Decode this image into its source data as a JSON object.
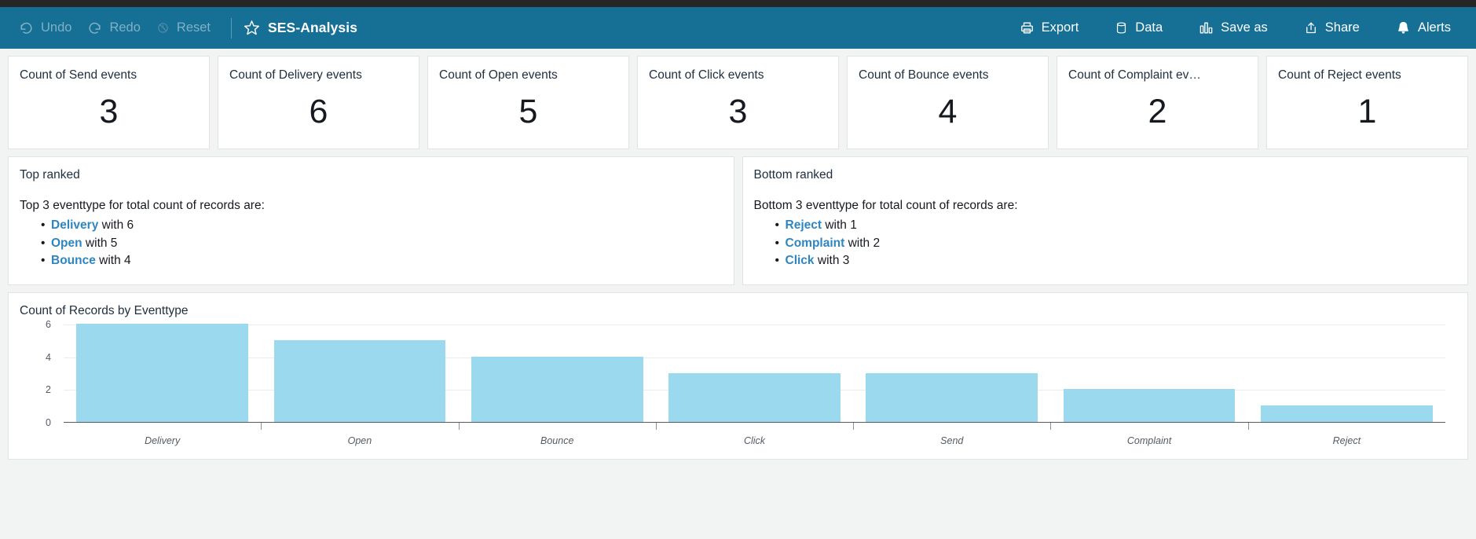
{
  "toolbar": {
    "undo": "Undo",
    "redo": "Redo",
    "reset": "Reset",
    "title": "SES-Analysis",
    "export": "Export",
    "data": "Data",
    "save_as": "Save as",
    "share": "Share",
    "alerts": "Alerts",
    "accent_color": "#166f94",
    "top_strip_color": "#262626"
  },
  "kpis": [
    {
      "title": "Count of Send events",
      "value": "3"
    },
    {
      "title": "Count of Delivery events",
      "value": "6"
    },
    {
      "title": "Count of Open events",
      "value": "5"
    },
    {
      "title": "Count of Click events",
      "value": "3"
    },
    {
      "title": "Count of Bounce events",
      "value": "4"
    },
    {
      "title": "Count of Complaint ev…",
      "value": "2"
    },
    {
      "title": "Count of Reject events",
      "value": "1"
    }
  ],
  "insights": {
    "top": {
      "header": "Top ranked",
      "lead": "Top 3 eventtype for total count of records are:",
      "items": [
        {
          "name": "Delivery",
          "rest": " with 6"
        },
        {
          "name": "Open",
          "rest": " with 5"
        },
        {
          "name": "Bounce",
          "rest": " with 4"
        }
      ]
    },
    "bottom": {
      "header": "Bottom ranked",
      "lead": "Bottom 3 eventtype for total count of records are:",
      "items": [
        {
          "name": "Reject",
          "rest": " with 1"
        },
        {
          "name": "Complaint",
          "rest": " with 2"
        },
        {
          "name": "Click",
          "rest": " with 3"
        }
      ]
    },
    "link_color": "#2e86c1"
  },
  "chart_data": {
    "type": "bar",
    "title": "Count of Records by Eventtype",
    "categories": [
      "Delivery",
      "Open",
      "Bounce",
      "Click",
      "Send",
      "Complaint",
      "Reject"
    ],
    "values": [
      6,
      5,
      4,
      3,
      3,
      2,
      1
    ],
    "xlabel": "",
    "ylabel": "",
    "ylim": [
      0,
      6
    ],
    "yticks": [
      "0",
      "2",
      "4",
      "6"
    ],
    "ytick_values": [
      0,
      2,
      4,
      6
    ],
    "grid": true,
    "legend": "none",
    "bar_color": "#9ad9ee"
  }
}
